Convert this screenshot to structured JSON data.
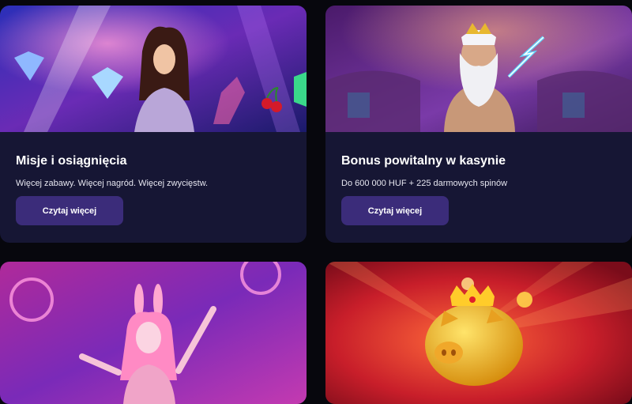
{
  "promos": [
    {
      "title": "Misje i osiągnięcia",
      "subtitle": "Więcej zabawy. Więcej nagród. Więcej zwycięstw.",
      "button_label": "Czytaj więcej",
      "image": "woman-holding-diamond-illustration"
    },
    {
      "title": "Bonus powitalny w kasynie",
      "subtitle": "Do 600 000 HUF + 225 darmowych spinów",
      "button_label": "Czytaj więcej",
      "image": "zeus-with-lightning-illustration"
    },
    {
      "image": "pink-bunny-girl-illustration"
    },
    {
      "image": "golden-piggy-bank-illustration"
    }
  ],
  "colors": {
    "page_bg": "#07070d",
    "card_bg": "#161634",
    "button_bg": "#3b2c7a"
  }
}
